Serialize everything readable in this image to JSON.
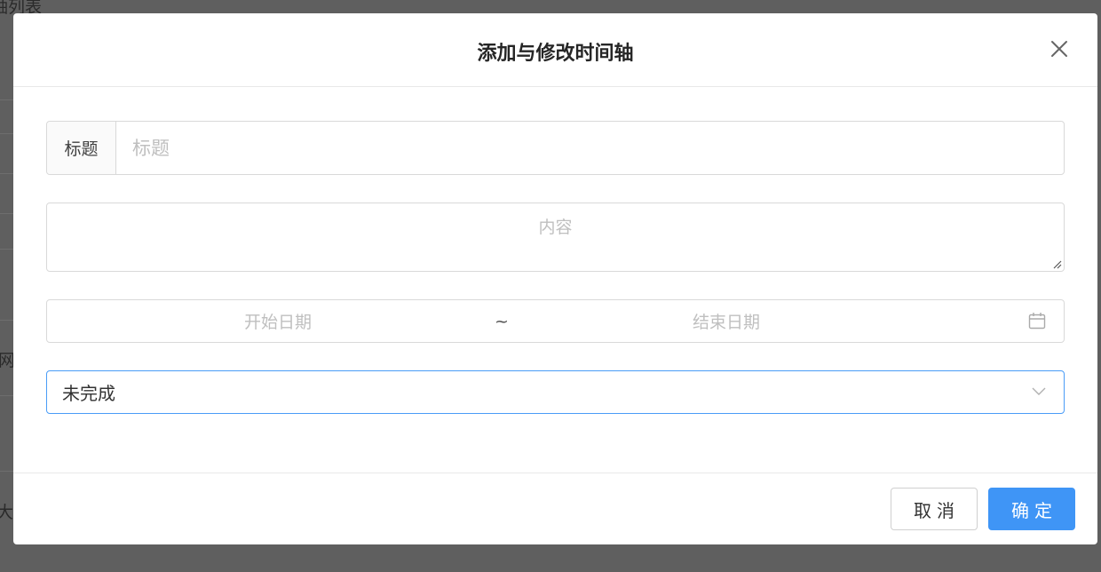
{
  "background": {
    "list_title": "轴列表",
    "fragment_1": "网",
    "fragment_2": "大"
  },
  "dialog": {
    "title": "添加与修改时间轴",
    "close_icon": "close-icon",
    "title_field": {
      "addon": "标题",
      "placeholder": "标题",
      "value": ""
    },
    "content_field": {
      "placeholder": "内容",
      "value": ""
    },
    "date_range": {
      "start_placeholder": "开始日期",
      "separator": "~",
      "end_placeholder": "结束日期",
      "icon": "calendar-icon"
    },
    "status_select": {
      "value": "未完成",
      "icon": "chevron-down-icon"
    },
    "footer": {
      "cancel_label": "取消",
      "ok_label": "确定"
    }
  },
  "colors": {
    "primary": "#3f95f6",
    "focus_border": "#4a9cf7",
    "overlay": "#5f5f5f"
  }
}
